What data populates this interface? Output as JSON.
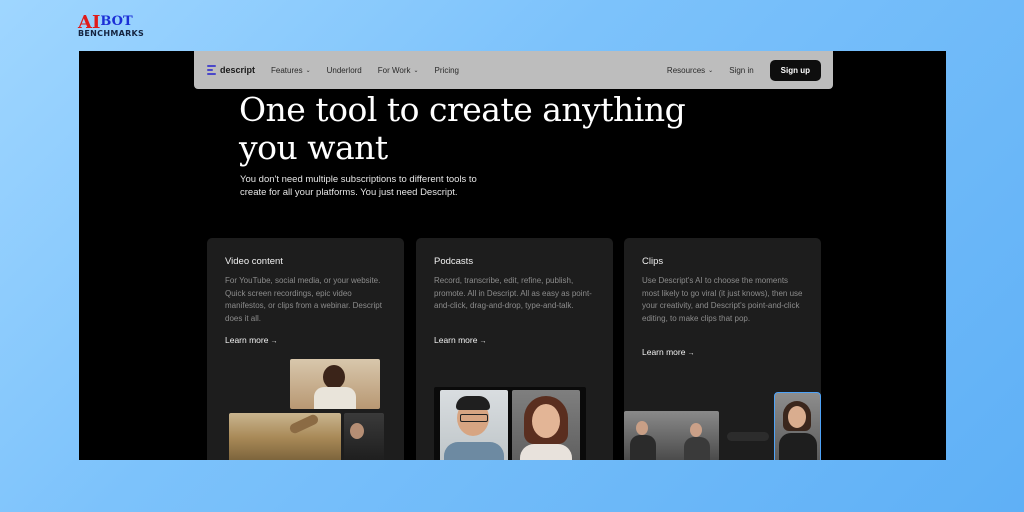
{
  "watermark": {
    "line1_a": "AI",
    "line1_b": "BOT",
    "line2": "BENCHMARKS"
  },
  "nav": {
    "brand": "descript",
    "items": [
      {
        "label": "Features",
        "dropdown": true
      },
      {
        "label": "Underlord",
        "dropdown": false
      },
      {
        "label": "For Work",
        "dropdown": true
      },
      {
        "label": "Pricing",
        "dropdown": false
      }
    ],
    "resources": "Resources",
    "sign_in": "Sign in",
    "sign_up": "Sign up"
  },
  "hero": {
    "title": "One tool to create anything you want",
    "subtitle": "You don't need multiple subscriptions to different tools to create for all your platforms. You just need Descript."
  },
  "cards": [
    {
      "title": "Video content",
      "body": "For YouTube, social media, or your website. Quick screen recordings, epic video manifestos, or clips from a webinar. Descript does it all.",
      "link": "Learn more"
    },
    {
      "title": "Podcasts",
      "body": "Record, transcribe, edit, refine, publish, promote. All in Descript. All as easy as point-and-click, drag-and-drop, type-and-talk.",
      "link": "Learn more"
    },
    {
      "title": "Clips",
      "body": "Use Descript's AI to choose the moments most likely to go viral (it just knows), then use your creativity, and Descript's point-and-click editing, to make clips that pop.",
      "link": "Learn more"
    }
  ],
  "colors": {
    "accent": "#4a47c9",
    "background_gradient": "#7cc2fb",
    "card_bg": "#1d1d1d"
  },
  "icons": {
    "arrow": "→",
    "chevron": "⌄"
  }
}
